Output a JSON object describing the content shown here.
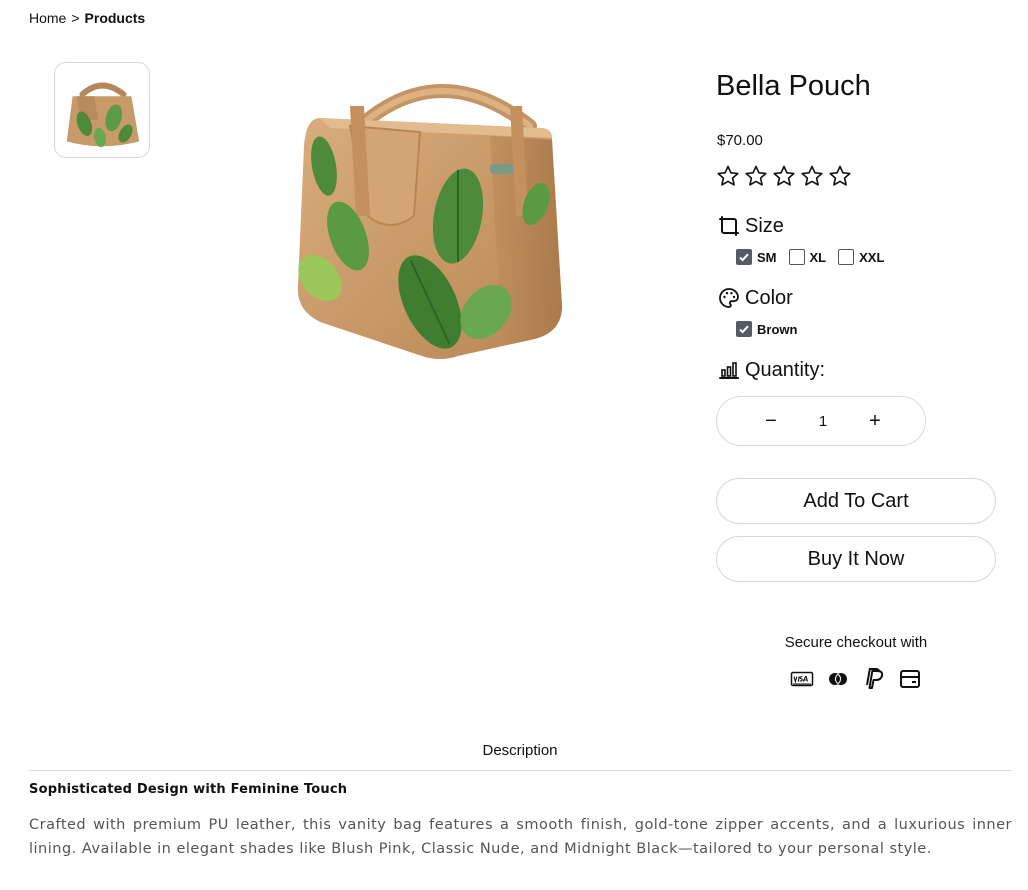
{
  "breadcrumb": {
    "home": "Home",
    "separator": ">",
    "current": "Products"
  },
  "product": {
    "title": "Bella Pouch",
    "price": "$70.00",
    "rating": {
      "value": 0,
      "max": 5
    }
  },
  "size": {
    "label": "Size",
    "options": [
      {
        "label": "SM",
        "checked": true
      },
      {
        "label": "XL",
        "checked": false
      },
      {
        "label": "XXL",
        "checked": false
      }
    ]
  },
  "color": {
    "label": "Color",
    "options": [
      {
        "label": "Brown",
        "checked": true
      }
    ]
  },
  "quantity": {
    "label": "Quantity:",
    "value": "1",
    "decrement": "−",
    "increment": "+"
  },
  "actions": {
    "add_to_cart": "Add To Cart",
    "buy_now": "Buy It Now"
  },
  "checkout": {
    "label": "Secure checkout with",
    "icons": [
      "visa-icon",
      "mastercard-icon",
      "paypal-icon",
      "card-icon"
    ]
  },
  "tabs": {
    "description": "Description"
  },
  "description": {
    "heading": "Sophisticated Design with Feminine Touch",
    "body": "Crafted with premium PU leather, this vanity bag features a smooth finish, gold-tone zipper accents, and a luxurious inner lining. Available in elegant shades like Blush Pink, Classic Nude, and Midnight Black—tailored to your personal style."
  },
  "colors": {
    "bag": "#c89a6a",
    "leaf": "#4d8a3a",
    "checkbox": "#555b66",
    "border": "#d9d9d9",
    "text_muted": "#555555"
  }
}
